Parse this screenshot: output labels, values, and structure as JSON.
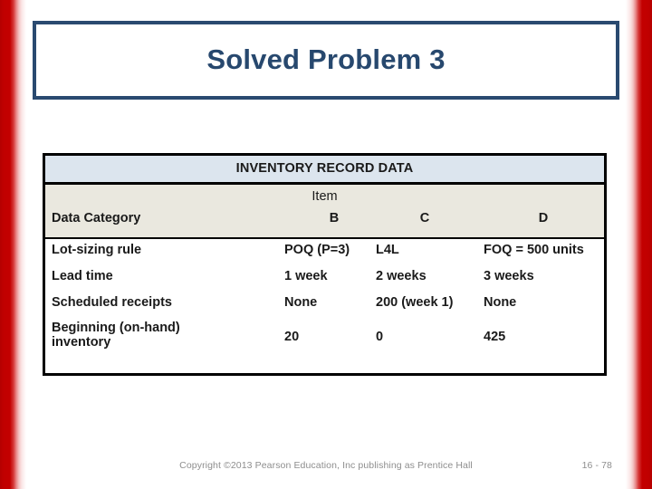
{
  "slide": {
    "title": "Solved Problem 3",
    "title_color": "#27486e",
    "accent_color": "#2a4a70",
    "edge_bar_color": "#c00000"
  },
  "table": {
    "caption": "INVENTORY RECORD DATA",
    "caption_bg": "#dce5ee",
    "colhead_bg": "#eae8df",
    "group_header": "Item",
    "columns": [
      {
        "key": "category",
        "label": "Data Category"
      },
      {
        "key": "b",
        "label": "B"
      },
      {
        "key": "c",
        "label": "C"
      },
      {
        "key": "d",
        "label": "D"
      }
    ],
    "rows": [
      {
        "category": "Lot-sizing rule",
        "b": "POQ (P=3)",
        "c": "L4L",
        "d": "FOQ = 500 units"
      },
      {
        "category": "Lead time",
        "b": "1 week",
        "c": "2 weeks",
        "d": "3 weeks"
      },
      {
        "category": "Scheduled receipts",
        "b": "None",
        "c": "200 (week 1)",
        "d": "None"
      },
      {
        "category_line1": "Beginning (on-hand)",
        "category_line2": "inventory",
        "b": "20",
        "c": "0",
        "d": "425"
      }
    ]
  },
  "footer": {
    "copyright": "Copyright ©2013 Pearson Education, Inc  publishing as Prentice Hall",
    "page_number": "16 - 78"
  }
}
